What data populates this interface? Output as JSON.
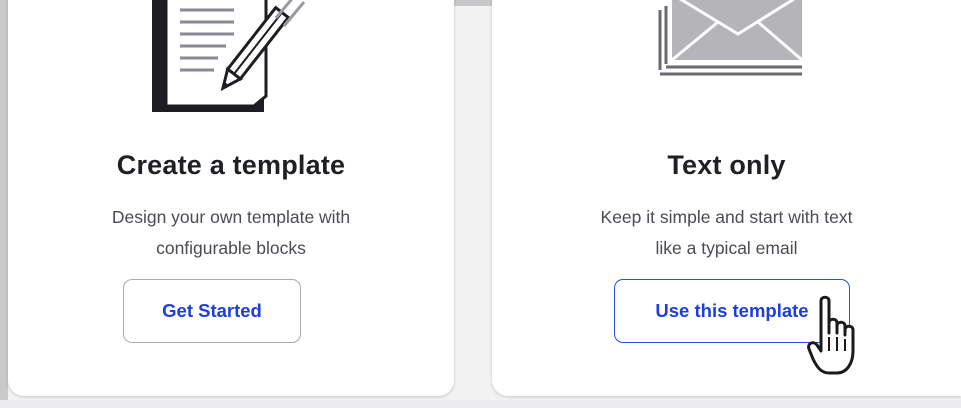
{
  "cards": [
    {
      "title": "Create a template",
      "description_line1": "Design your own template with",
      "description_line2": "configurable blocks",
      "button_label": "Get Started",
      "illustration": "document-pencil-icon"
    },
    {
      "title": "Text only",
      "description_line1": "Keep it simple and start with text",
      "description_line2": "like a typical email",
      "button_label": "Use this template",
      "illustration": "envelope-icon"
    }
  ],
  "colors": {
    "button_text": "#1d3fd8",
    "active_button_border": "#2a4ee0",
    "title_text": "#1f1f24",
    "description_text": "#4b4b52"
  },
  "cursor": "hand-pointer-icon"
}
